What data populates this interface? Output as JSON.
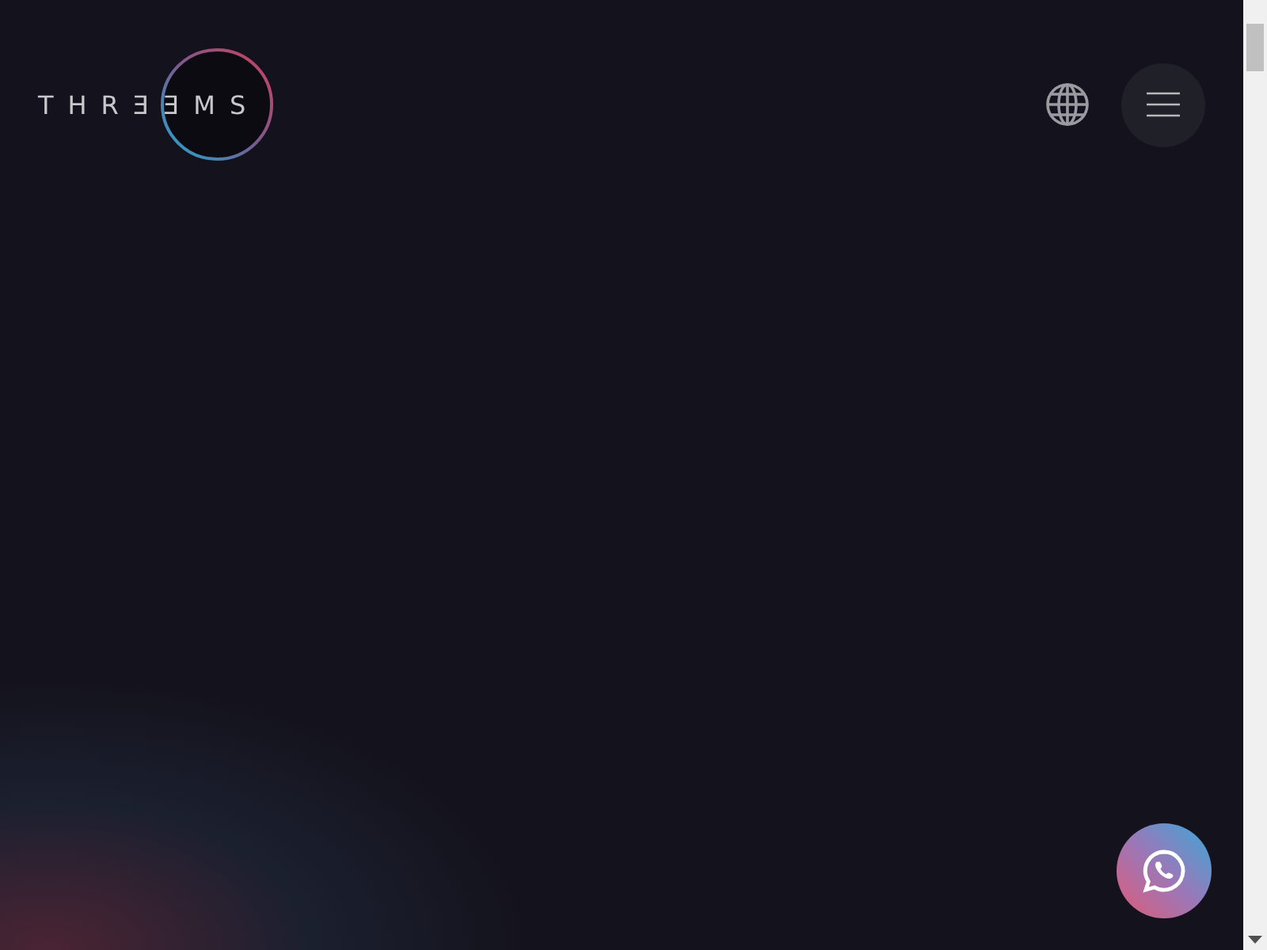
{
  "header": {
    "logo": "THRƎƎMS"
  }
}
